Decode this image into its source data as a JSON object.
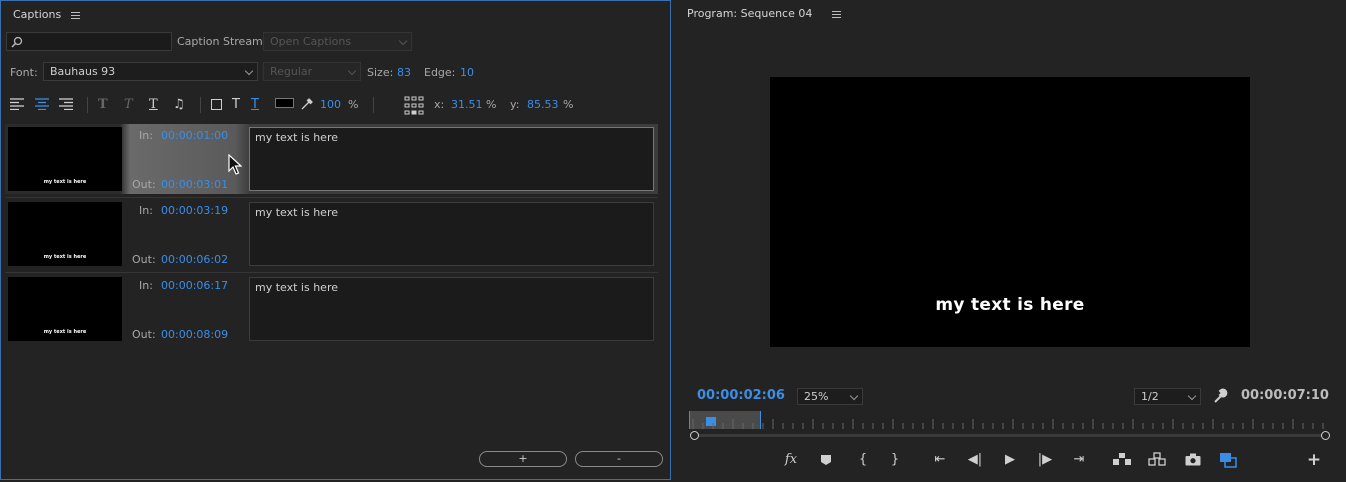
{
  "captions": {
    "title": "Captions",
    "stream_label": "Caption Stream:",
    "stream_value": "Open Captions",
    "font_label": "Font:",
    "font_value": "Bauhaus 93",
    "style_value": "Regular",
    "size_label": "Size:",
    "size_value": "83",
    "edge_label": "Edge:",
    "edge_value": "10",
    "opacity_value": "100",
    "percent": "%",
    "x_label": "x:",
    "x_value": "31.51",
    "y_label": "y:",
    "y_value": "85.53",
    "in_label": "In:",
    "out_label": "Out:",
    "rows": [
      {
        "in": "00:00:01:00",
        "out": "00:00:03:01",
        "text": "my text is here",
        "thumb": "my text is here"
      },
      {
        "in": "00:00:03:19",
        "out": "00:00:06:02",
        "text": "my text is here",
        "thumb": "my text is here"
      },
      {
        "in": "00:00:06:17",
        "out": "00:00:08:09",
        "text": "my text is here",
        "thumb": "my text is here"
      }
    ],
    "add_label": "+",
    "remove_label": "-"
  },
  "program": {
    "title": "Program: Sequence 04",
    "video_text": "my text is here",
    "current_tc": "00:00:02:06",
    "zoom": "25%",
    "resolution": "1/2",
    "duration_tc": "00:00:07:10",
    "fx_label": "fx"
  },
  "colors": {
    "accent": "#3a8ee6",
    "panel_border": "#3c6fb0"
  }
}
